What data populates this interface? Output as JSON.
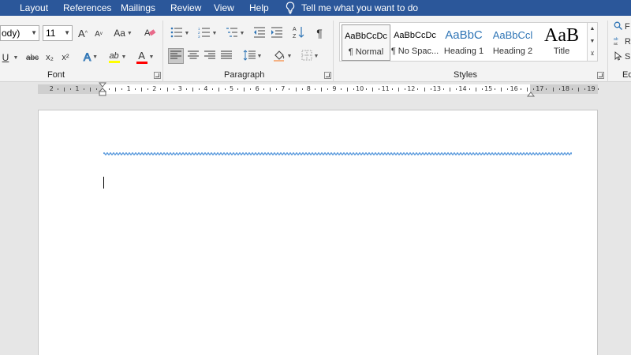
{
  "tabs": [
    "Layout",
    "References",
    "Mailings",
    "Review",
    "View",
    "Help"
  ],
  "tell_me": "Tell me what you want to do",
  "font": {
    "name_value": "ody)",
    "size_value": "11",
    "grow_label": "A",
    "shrink_label": "A",
    "case_label": "Aa",
    "underline_label": "U",
    "strike_label": "abc",
    "subscript_label": "x₂",
    "superscript_label": "x²",
    "effects_label": "A",
    "highlight_label": "ab",
    "color_label": "A",
    "group_label": "Font"
  },
  "paragraph": {
    "group_label": "Paragraph",
    "pilcrow": "¶"
  },
  "styles": {
    "group_label": "Styles",
    "items": [
      {
        "preview": "AaBbCcDc",
        "name": "¶ Normal"
      },
      {
        "preview": "AaBbCcDc",
        "name": "¶ No Spac..."
      },
      {
        "preview": "AaBbC",
        "name": "Heading 1"
      },
      {
        "preview": "AaBbCcl",
        "name": "Heading 2"
      },
      {
        "preview": "AaB",
        "name": "Title"
      }
    ]
  },
  "editing": {
    "group_label": "Ed",
    "find_label": "F",
    "replace_label": "R",
    "select_label": "S"
  },
  "ruler": {
    "numbers": [
      "2",
      "1",
      "1",
      "2",
      "3",
      "4",
      "5",
      "6",
      "7",
      "8",
      "9",
      "10",
      "11",
      "12",
      "13",
      "14",
      "15",
      "16",
      "17",
      "18",
      "19"
    ]
  },
  "colors": {
    "title_bar": "#2b579a",
    "ribbon": "#f3f3f3",
    "highlight": "#ffff00",
    "font_color": "#ff0000",
    "heading": "#2e74b5",
    "squiggle": "#4a90d9"
  }
}
